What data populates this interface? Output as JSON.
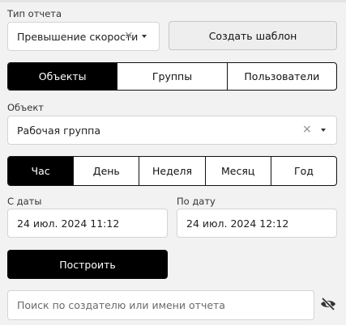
{
  "report_type": {
    "label": "Тип отчета",
    "value": "Превышение скорости",
    "clear_icon": "close-icon",
    "dropdown_icon": "caret-down-icon"
  },
  "create_template_label": "Создать шаблон",
  "entity_tabs": [
    "Объекты",
    "Группы",
    "Пользователи"
  ],
  "entity_tabs_active": 0,
  "object": {
    "label": "Объект",
    "value": "Рабочая группа",
    "clear_icon": "close-icon",
    "dropdown_icon": "caret-down-icon"
  },
  "period_tabs": [
    "Час",
    "День",
    "Неделя",
    "Месяц",
    "Год"
  ],
  "period_tabs_active": 0,
  "date_from": {
    "label": "С даты",
    "value": "24 июл. 2024 11:12"
  },
  "date_to": {
    "label": "По дату",
    "value": "24 июл. 2024 12:12"
  },
  "build_label": "Построить",
  "search": {
    "placeholder": "Поиск по создателю или имени отчета",
    "icon": "eye-off-icon"
  },
  "colors": {
    "background": "#f2f2f2",
    "active": "#000000",
    "field_border": "#d4d4d4"
  }
}
